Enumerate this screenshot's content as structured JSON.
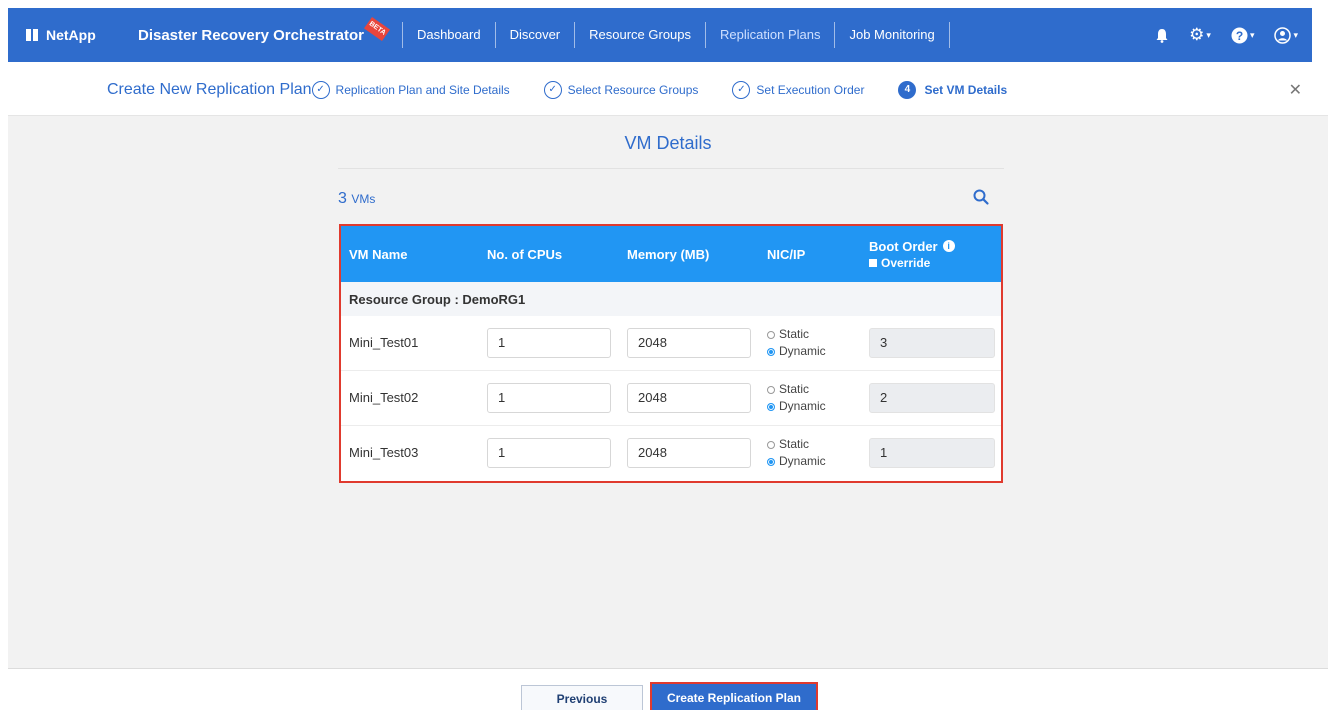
{
  "brand": "NetApp",
  "app_title": "Disaster Recovery Orchestrator",
  "beta_badge": "BETA",
  "nav": {
    "links": [
      "Dashboard",
      "Discover",
      "Resource Groups",
      "Replication Plans",
      "Job Monitoring"
    ],
    "active": "Replication Plans"
  },
  "wizard": {
    "title": "Create New Replication Plan",
    "steps": [
      {
        "label": "Replication Plan and Site Details",
        "state": "done"
      },
      {
        "label": "Select Resource Groups",
        "state": "done"
      },
      {
        "label": "Set Execution Order",
        "state": "done"
      },
      {
        "label": "Set VM Details",
        "state": "current",
        "number": "4"
      }
    ]
  },
  "vm_details": {
    "title": "VM Details",
    "count": "3",
    "count_unit": "VMs",
    "columns": {
      "name": "VM Name",
      "cpus": "No. of CPUs",
      "memory": "Memory (MB)",
      "nic": "NIC/IP",
      "boot": "Boot Order",
      "override": "Override"
    },
    "group_label": "Resource Group : DemoRG1",
    "rows": [
      {
        "name": "Mini_Test01",
        "cpus": "1",
        "memory": "2048",
        "static": "Static",
        "dynamic": "Dynamic",
        "boot": "3"
      },
      {
        "name": "Mini_Test02",
        "cpus": "1",
        "memory": "2048",
        "static": "Static",
        "dynamic": "Dynamic",
        "boot": "2"
      },
      {
        "name": "Mini_Test03",
        "cpus": "1",
        "memory": "2048",
        "static": "Static",
        "dynamic": "Dynamic",
        "boot": "1"
      }
    ]
  },
  "footer": {
    "previous": "Previous",
    "create": "Create Replication Plan"
  },
  "colors": {
    "primary": "#2f6ccc",
    "table_header": "#2196f3",
    "highlight": "#e03a2e"
  }
}
